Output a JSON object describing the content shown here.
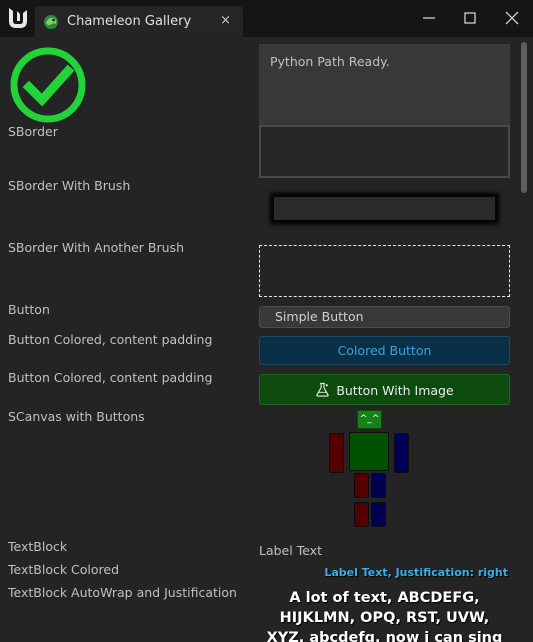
{
  "window": {
    "tab_title": "Chameleon Gallery",
    "tab_close_glyph": "×"
  },
  "rows": {
    "sborder_label": "SBorder",
    "sborder_brush_label": "SBorder With Brush",
    "sborder_another_brush_label": "SBorder With Another Brush",
    "button_label": "Button",
    "button_colored_label_1": "Button Colored, content padding",
    "button_colored_label_2": "Button Colored, content padding",
    "scanvas_label": "SCanvas with Buttons",
    "textblock_label": "TextBlock",
    "textblock_colored_label": "TextBlock Colored",
    "textblock_autowrap_label": "TextBlock AutoWrap and Justification"
  },
  "widgets": {
    "python_status": "Python Path Ready.",
    "simple_button": "Simple Button",
    "colored_button": "Colored Button",
    "image_button": "Button With Image",
    "robot_face": "^_^",
    "label_text": "Label Text",
    "label_text_right": "Label Text, Justification: right",
    "wrap_text": "A lot of text, ABCDEFG, HIJKLMN, OPQ, RST, UVW, XYZ. abcdefg, now i can sing my ABC"
  },
  "icons": {
    "app_logo": "unreal-logo-icon",
    "tab_icon": "chameleon-icon",
    "check": "check-circle-icon",
    "button_image": "flask-icon"
  },
  "colors": {
    "check_green": "#22d43a",
    "colored_button_bg": "#0a3048",
    "colored_button_text": "#3aa2d8",
    "image_button_bg": "#0d4a0d",
    "label_right_color": "#3ab0e8"
  }
}
